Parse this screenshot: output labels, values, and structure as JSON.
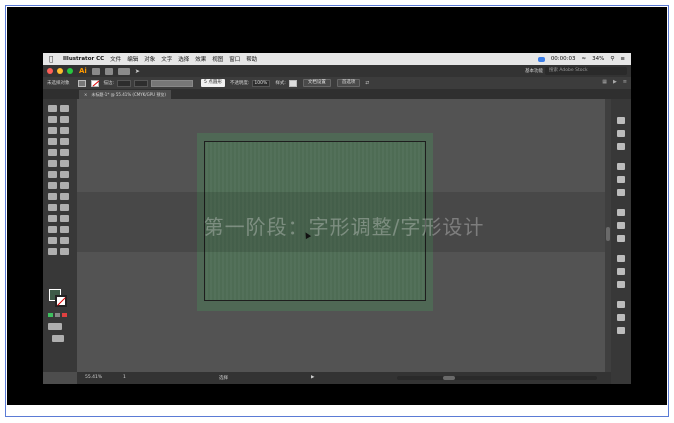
{
  "menubar": {
    "app_name": "Illustrator CC",
    "items": [
      "文件",
      "编辑",
      "对象",
      "文字",
      "选择",
      "效果",
      "视图",
      "窗口",
      "帮助"
    ],
    "timer": "00:00:03",
    "battery": "34%"
  },
  "appbar": {
    "logo": "Ai",
    "workspace": "基本功能",
    "stock_search_placeholder": "搜索 Adobe Stock"
  },
  "controlbar": {
    "selection_label": "未选择对象",
    "stroke_label": "描边:",
    "brush_label": "5 点圆形",
    "opacity_label": "不透明度:",
    "opacity_value": "100%",
    "style_label": "样式:",
    "doc_setup_button": "文档设置",
    "prefs_button": "首选项"
  },
  "document": {
    "tab_title": "未标题-1* @ 55.41% (CMYK/GPU 预览)"
  },
  "canvas": {
    "overlay_title": "第一阶段：字形调整/字形设计"
  },
  "statusbar": {
    "zoom": "55.41%",
    "artboard_number": "1",
    "mode": "选择"
  },
  "colors": {
    "artboard_fill": "#4f6a55",
    "ui_dark": "#333333",
    "accent_orange": "#ff9a00"
  }
}
